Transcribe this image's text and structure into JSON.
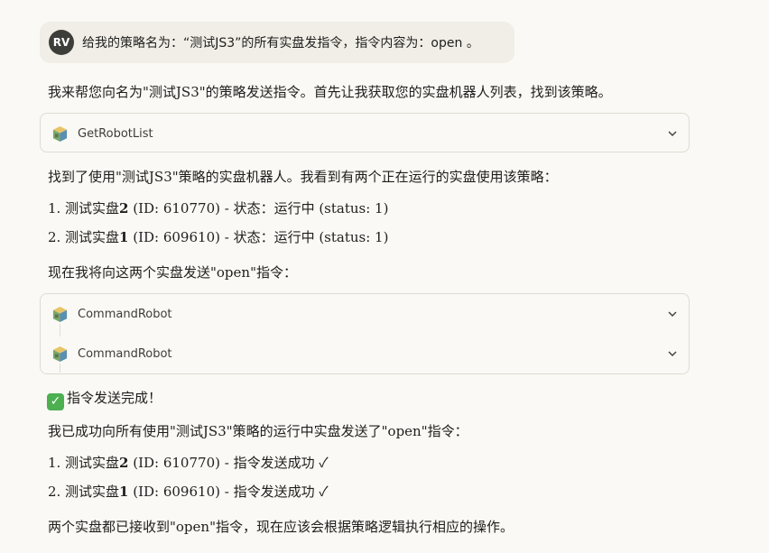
{
  "user_message": {
    "avatar_initials": "RV",
    "text": "给我的策略名为：“测试JS3”的所有实盘发指令，指令内容为：open 。"
  },
  "assistant": {
    "intro": "我来帮您向名为\"测试JS3\"的策略发送指令。首先让我获取您的实盘机器人列表，找到该策略。",
    "tool_call_1": {
      "name": "GetRobotList",
      "icon": "package-icon"
    },
    "found_text": "找到了使用\"测试JS3\"策略的实盘机器人。我看到有两个正在运行的实盘使用该策略：",
    "robots": [
      {
        "num": "1.",
        "name_prefix": "测试实盘",
        "name_num": "2",
        "detail": " (ID: 610770) - 状态：运行中 (status: 1)"
      },
      {
        "num": "2.",
        "name_prefix": "测试实盘",
        "name_num": "1",
        "detail": " (ID: 609610) - 状态：运行中 (status: 1)"
      }
    ],
    "now_sending": "现在我将向这两个实盘发送\"open\"指令：",
    "tool_call_2": {
      "name": "CommandRobot",
      "icon": "package-icon"
    },
    "tool_call_3": {
      "name": "CommandRobot",
      "icon": "package-icon"
    },
    "done_icon": "white-check-mark-icon",
    "done_text": "指令发送完成！",
    "success_text": "我已成功向所有使用\"测试JS3\"策略的运行中实盘发送了\"open\"指令：",
    "results": [
      {
        "num": "1.",
        "name_prefix": "测试实盘",
        "name_num": "2",
        "detail": " (ID: 610770) - 指令发送成功 ✓"
      },
      {
        "num": "2.",
        "name_prefix": "测试实盘",
        "name_num": "1",
        "detail": " (ID: 609610) - 指令发送成功 ✓"
      }
    ],
    "closing": "两个实盘都已接收到\"open\"指令，现在应该会根据策略逻辑执行相应的操作。"
  }
}
